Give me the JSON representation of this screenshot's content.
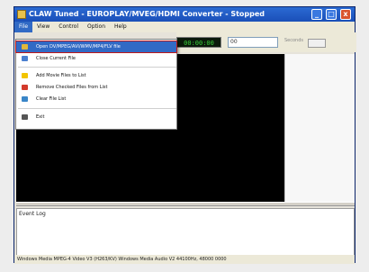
{
  "window": {
    "title": "CLAW Tuned - EUROPLAY/MVEG/HDMI Converter - Stopped",
    "min_label": "_",
    "max_label": "□",
    "close_label": "x"
  },
  "menubar": {
    "items": [
      "File",
      "View",
      "Control",
      "Option",
      "Help"
    ]
  },
  "toolbar": {
    "time": "00:00:00",
    "box1_value": "00",
    "label2": "Seconds"
  },
  "file_menu": {
    "items": [
      {
        "label": "Open DV/MPEG/AVI/WMV/MP4/FLV file",
        "icon": "folder-open-icon"
      },
      {
        "label": "Close Current File",
        "icon": "close-file-icon"
      },
      {
        "label": "Add Movie Files to List",
        "icon": "add-icon"
      },
      {
        "label": "Remove Checked Files from List",
        "icon": "remove-icon"
      },
      {
        "label": "Clear File List",
        "icon": "clear-list-icon"
      },
      {
        "label": "Exit",
        "icon": "exit-icon"
      }
    ]
  },
  "log": {
    "text": "Event Log"
  },
  "status": {
    "text": "Windows Media MPEG-4 Video V3 (H263/KV) Windows Media Audio V2 44100Hz, 48000 0000"
  }
}
